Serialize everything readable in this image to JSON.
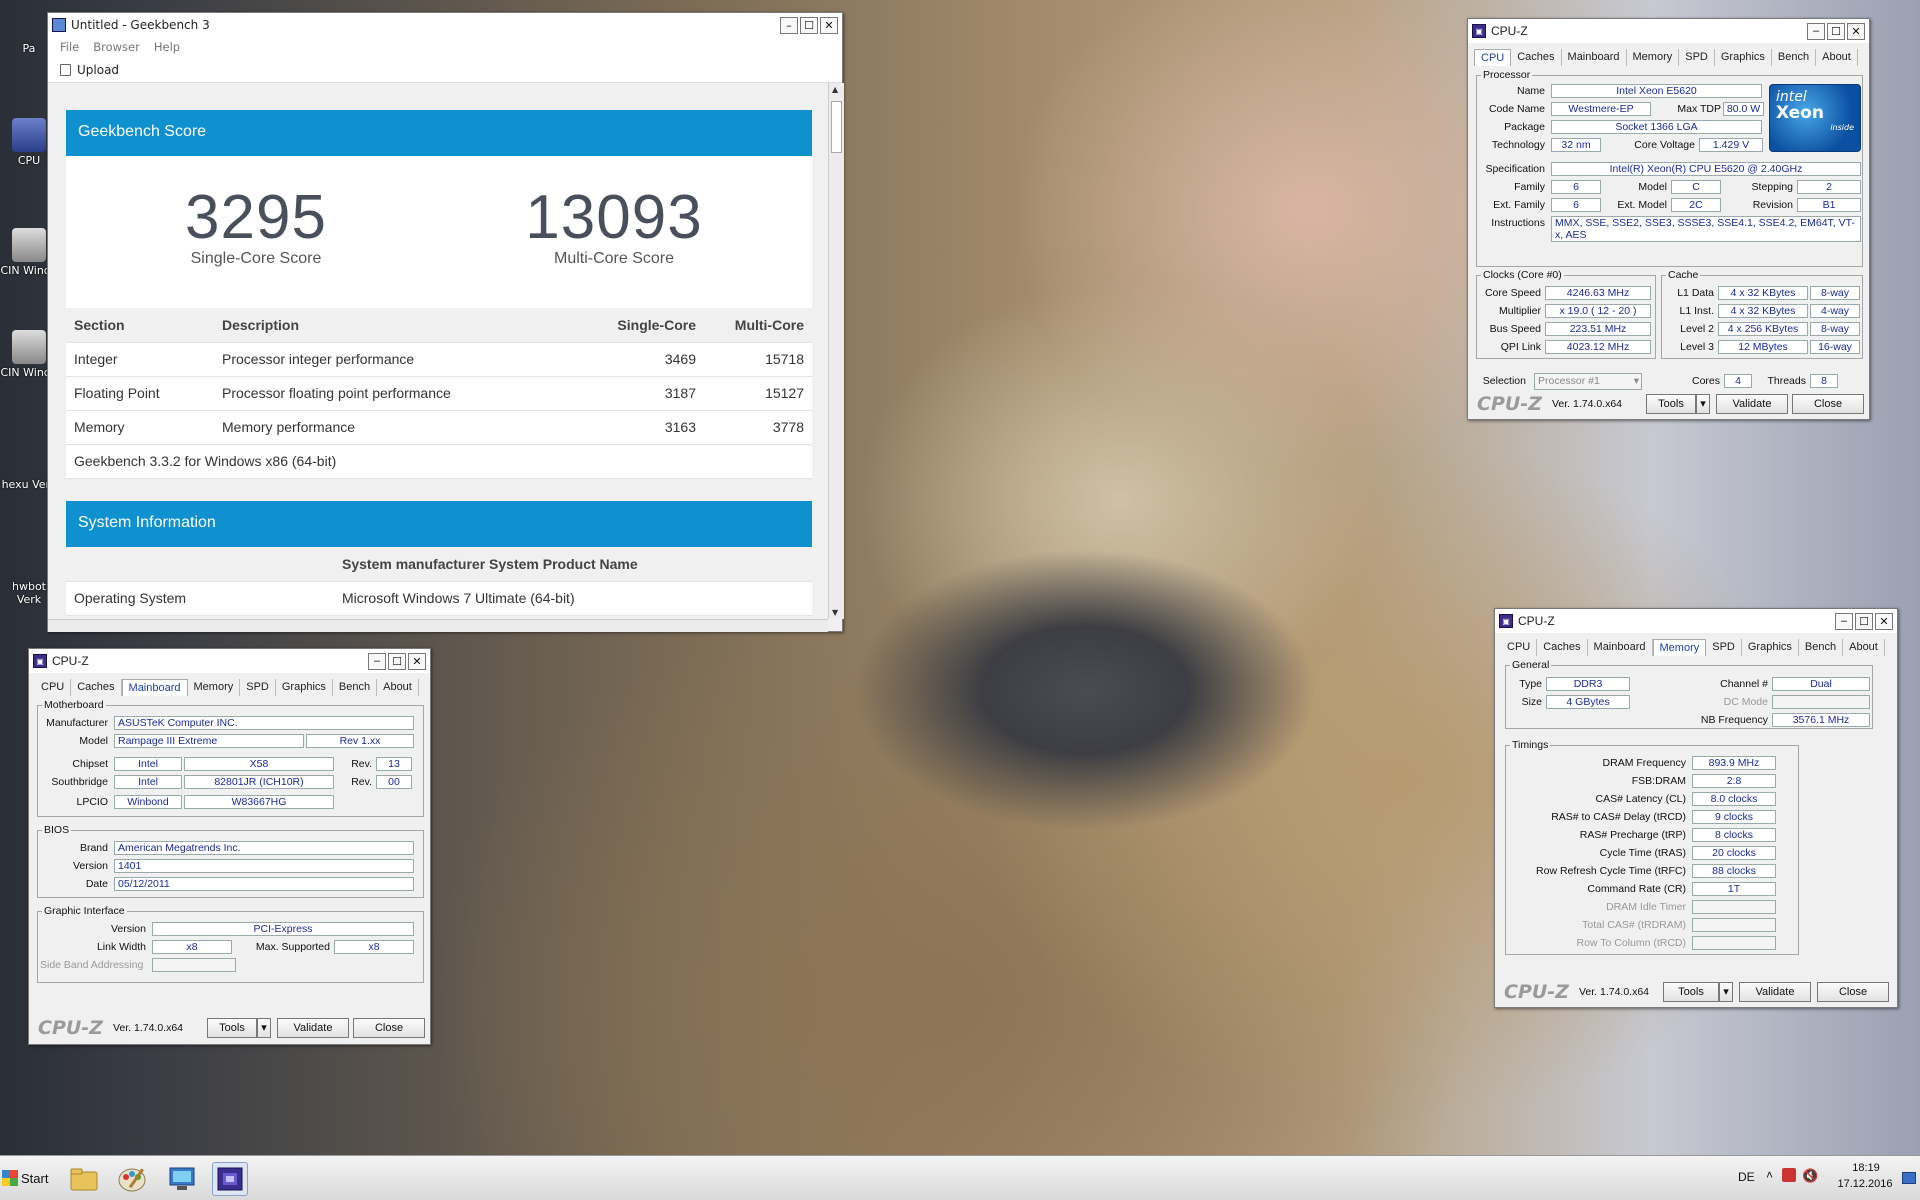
{
  "desktop": {
    "icons": [
      {
        "label": "Pa"
      },
      {
        "label": "CPU"
      },
      {
        "label": "CIN Windo"
      },
      {
        "label": "CIN Windo"
      },
      {
        "label": "hexu Verk"
      },
      {
        "label": "hwbot Verk"
      }
    ]
  },
  "geekbench": {
    "title": "Untitled - Geekbench 3",
    "menu": [
      "File",
      "Browser",
      "Help"
    ],
    "upload_label": "Upload",
    "score_header": "Geekbench Score",
    "single_score": "3295",
    "single_label": "Single-Core Score",
    "multi_score": "13093",
    "multi_label": "Multi-Core Score",
    "columns": [
      "Section",
      "Description",
      "Single-Core",
      "Multi-Core"
    ],
    "rows": [
      {
        "section": "Integer",
        "description": "Processor integer performance",
        "single": "3469",
        "multi": "15718"
      },
      {
        "section": "Floating Point",
        "description": "Processor floating point performance",
        "single": "3187",
        "multi": "15127"
      },
      {
        "section": "Memory",
        "description": "Memory performance",
        "single": "3163",
        "multi": "3778"
      }
    ],
    "version_note": "Geekbench 3.3.2 for Windows x86 (64-bit)",
    "sysinfo_header": "System Information",
    "sysinfo_product": "System manufacturer System Product Name",
    "os_label": "Operating System",
    "os_value": "Microsoft Windows 7 Ultimate (64-bit)"
  },
  "cpuz_common": {
    "title": "CPU-Z",
    "tabs": [
      "CPU",
      "Caches",
      "Mainboard",
      "Memory",
      "SPD",
      "Graphics",
      "Bench",
      "About"
    ],
    "logo": "CPU-Z",
    "version": "Ver. 1.74.0.x64",
    "tools": "Tools",
    "validate": "Validate",
    "close": "Close"
  },
  "cpuz_cpu": {
    "processor_group": "Processor",
    "name_label": "Name",
    "name": "Intel Xeon E5620",
    "codename_label": "Code Name",
    "codename": "Westmere-EP",
    "maxtdp_label": "Max TDP",
    "maxtdp": "80.0 W",
    "package_label": "Package",
    "package": "Socket 1366 LGA",
    "technology_label": "Technology",
    "technology": "32 nm",
    "corevoltage_label": "Core Voltage",
    "corevoltage": "1.429 V",
    "spec_label": "Specification",
    "spec": "Intel(R) Xeon(R) CPU        E5620  @ 2.40GHz",
    "family_label": "Family",
    "family": "6",
    "model_label": "Model",
    "model": "C",
    "stepping_label": "Stepping",
    "stepping": "2",
    "extfamily_label": "Ext. Family",
    "extfamily": "6",
    "extmodel_label": "Ext. Model",
    "extmodel": "2C",
    "revision_label": "Revision",
    "revision": "B1",
    "instructions_label": "Instructions",
    "instructions": "MMX, SSE, SSE2, SSE3, SSSE3, SSE4.1, SSE4.2, EM64T, VT-x, AES",
    "logo_brand": "intel",
    "logo_product": "Xeon",
    "logo_inside": "inside",
    "clocks_group": "Clocks (Core #0)",
    "corespeed_label": "Core Speed",
    "corespeed": "4246.63 MHz",
    "multiplier_label": "Multiplier",
    "multiplier": "x 19.0 ( 12 - 20 )",
    "busspeed_label": "Bus Speed",
    "busspeed": "223.51 MHz",
    "qpilink_label": "QPI Link",
    "qpilink": "4023.12 MHz",
    "cache_group": "Cache",
    "l1d_label": "L1 Data",
    "l1d": "4 x 32 KBytes",
    "l1d_way": "8-way",
    "l1i_label": "L1 Inst.",
    "l1i": "4 x 32 KBytes",
    "l1i_way": "4-way",
    "l2_label": "Level 2",
    "l2": "4 x 256 KBytes",
    "l2_way": "8-way",
    "l3_label": "Level 3",
    "l3": "12 MBytes",
    "l3_way": "16-way",
    "selection_label": "Selection",
    "selection": "Processor #1",
    "cores_label": "Cores",
    "cores": "4",
    "threads_label": "Threads",
    "threads": "8"
  },
  "cpuz_mainboard": {
    "mb_group": "Motherboard",
    "manufacturer_label": "Manufacturer",
    "manufacturer": "ASUSTeK Computer INC.",
    "model_label": "Model",
    "model": "Rampage III Extreme",
    "model_rev": "Rev 1.xx",
    "chipset_label": "Chipset",
    "chipset_vendor": "Intel",
    "chipset": "X58",
    "chipset_rev_label": "Rev.",
    "chipset_rev": "13",
    "southbridge_label": "Southbridge",
    "sb_vendor": "Intel",
    "sb": "82801JR (ICH10R)",
    "sb_rev_label": "Rev.",
    "sb_rev": "00",
    "lpcio_label": "LPCIO",
    "lpcio_vendor": "Winbond",
    "lpcio": "W83667HG",
    "bios_group": "BIOS",
    "brand_label": "Brand",
    "brand": "American Megatrends Inc.",
    "version_label": "Version",
    "version": "1401",
    "date_label": "Date",
    "date": "05/12/2011",
    "gi_group": "Graphic Interface",
    "gi_version_label": "Version",
    "gi_version": "PCI-Express",
    "linkwidth_label": "Link Width",
    "linkwidth": "x8",
    "maxsupported_label": "Max. Supported",
    "maxsupported": "x8",
    "sideband_label": "Side Band Addressing"
  },
  "cpuz_memory": {
    "general_group": "General",
    "type_label": "Type",
    "type": "DDR3",
    "channel_label": "Channel #",
    "channel": "Dual",
    "size_label": "Size",
    "size": "4 GBytes",
    "dcmode_label": "DC Mode",
    "nbfreq_label": "NB Frequency",
    "nbfreq": "3576.1 MHz",
    "timings_group": "Timings",
    "timings": [
      {
        "label": "DRAM Frequency",
        "value": "893.9 MHz"
      },
      {
        "label": "FSB:DRAM",
        "value": "2:8"
      },
      {
        "label": "CAS# Latency (CL)",
        "value": "8.0 clocks"
      },
      {
        "label": "RAS# to CAS# Delay (tRCD)",
        "value": "9 clocks"
      },
      {
        "label": "RAS# Precharge (tRP)",
        "value": "8 clocks"
      },
      {
        "label": "Cycle Time (tRAS)",
        "value": "20 clocks"
      },
      {
        "label": "Row Refresh Cycle Time (tRFC)",
        "value": "88 clocks"
      },
      {
        "label": "Command Rate (CR)",
        "value": "1T"
      }
    ],
    "dim_timings": [
      "DRAM Idle Timer",
      "Total CAS# (tRDRAM)",
      "Row To Column (tRCD)"
    ]
  },
  "taskbar": {
    "start_label": "Start",
    "lang": "DE",
    "time": "18:19",
    "date": "17.12.2016"
  }
}
